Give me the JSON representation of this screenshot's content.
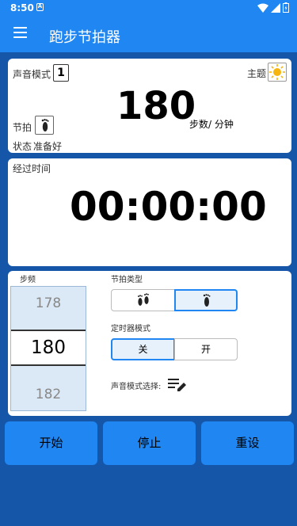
{
  "status_bar": {
    "time": "8:50",
    "note_glyph": "A",
    "battery_text": ""
  },
  "app_bar": {
    "title": "跑步节拍器",
    "menu_icon": "hamburger-icon"
  },
  "metronome_card": {
    "sound_mode_label": "声音模式",
    "sound_mode_value": "1",
    "theme_label": "主题",
    "bpm_value": "180",
    "bpm_unit": "步数/ 分钟",
    "beat_label": "节拍",
    "status_label": "状态",
    "status_value": "准备好"
  },
  "elapsed_card": {
    "label": "经过时间",
    "time": "00:00:00"
  },
  "settings_card": {
    "cadence_label": "步频",
    "cadence_prev": "178",
    "cadence_current": "180",
    "cadence_next": "182",
    "beat_type_label": "节拍类型",
    "timer_mode_label": "定时器模式",
    "timer_off": "关",
    "timer_on": "开",
    "sound_select_label": "声音模式选择:"
  },
  "buttons": {
    "start": "开始",
    "stop": "停止",
    "reset": "重设"
  },
  "colors": {
    "primary": "#1f86f2",
    "background": "#1656a8",
    "active_segment": "#e6f1fc"
  }
}
